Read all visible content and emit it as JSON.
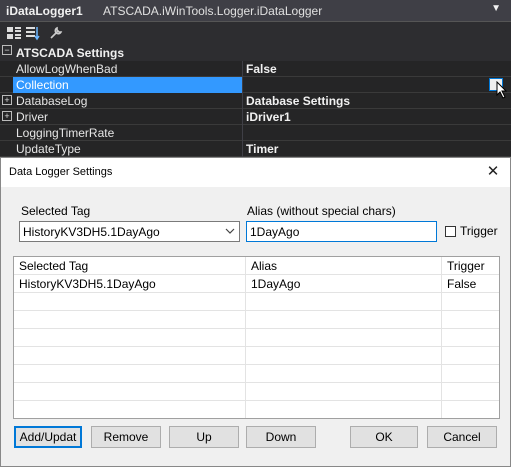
{
  "property_grid": {
    "object_name": "iDataLogger1",
    "object_type": "ATSCADA.iWinTools.Logger.iDataLogger",
    "category": "ATSCADA Settings",
    "rows": [
      {
        "name": "AllowLogWhenBad",
        "value": "False",
        "expandable": false,
        "selected": false
      },
      {
        "name": "Collection",
        "value": "",
        "expandable": false,
        "selected": true
      },
      {
        "name": "DatabaseLog",
        "value": "Database Settings",
        "expandable": true,
        "selected": false
      },
      {
        "name": "Driver",
        "value": "iDriver1",
        "expandable": true,
        "selected": false
      },
      {
        "name": "LoggingTimerRate",
        "value": "",
        "expandable": false,
        "selected": false
      },
      {
        "name": "UpdateType",
        "value": "Timer",
        "expandable": false,
        "selected": false
      }
    ]
  },
  "dialog": {
    "title": "Data Logger Settings",
    "close_glyph": "✕",
    "selected_tag_label": "Selected Tag",
    "selected_tag_value": "HistoryKV3DH5.1DayAgo",
    "alias_label": "Alias (without special chars)",
    "alias_value": "1DayAgo",
    "trigger_label": "Trigger",
    "trigger_checked": false,
    "grid": {
      "headers": [
        "Selected Tag",
        "Alias",
        "Trigger"
      ],
      "rows": [
        [
          "HistoryKV3DH5.1DayAgo",
          "1DayAgo",
          "False"
        ]
      ]
    },
    "buttons": {
      "add_update": "Add/Updat",
      "remove": "Remove",
      "up": "Up",
      "down": "Down",
      "ok": "OK",
      "cancel": "Cancel"
    }
  }
}
